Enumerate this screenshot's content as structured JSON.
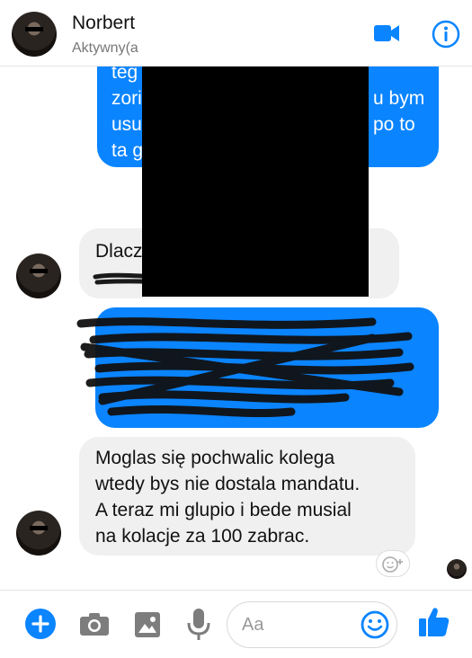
{
  "header": {
    "contact_name": "Norbert",
    "status": "Aktywny(a",
    "icons": [
      "video-call-icon",
      "info-icon"
    ]
  },
  "messages": [
    {
      "side": "out",
      "lines": [
        "teg",
        "zori",
        "usu",
        "ta g"
      ],
      "right_fragments": [
        "u bym",
        "po to"
      ]
    },
    {
      "side": "in",
      "lines": [
        "Dlaczego nie mowilas ze znasz",
        "?"
      ]
    },
    {
      "side": "out",
      "note": "redacted"
    },
    {
      "side": "in",
      "lines": [
        "Moglas się pochwalic kolega",
        "wtedy bys nie dostala mandatu.",
        "A teraz mi glupio i bede musial",
        "na kolacje za 100 zabrac."
      ]
    }
  ],
  "composer": {
    "placeholder": "Aa",
    "icons": [
      "plus-icon",
      "camera-icon",
      "image-icon",
      "microphone-icon",
      "emoji-icon",
      "thumbs-up-icon"
    ]
  },
  "colors": {
    "accent": "#0a84ff",
    "incoming_bubble": "#f0f0f0"
  }
}
